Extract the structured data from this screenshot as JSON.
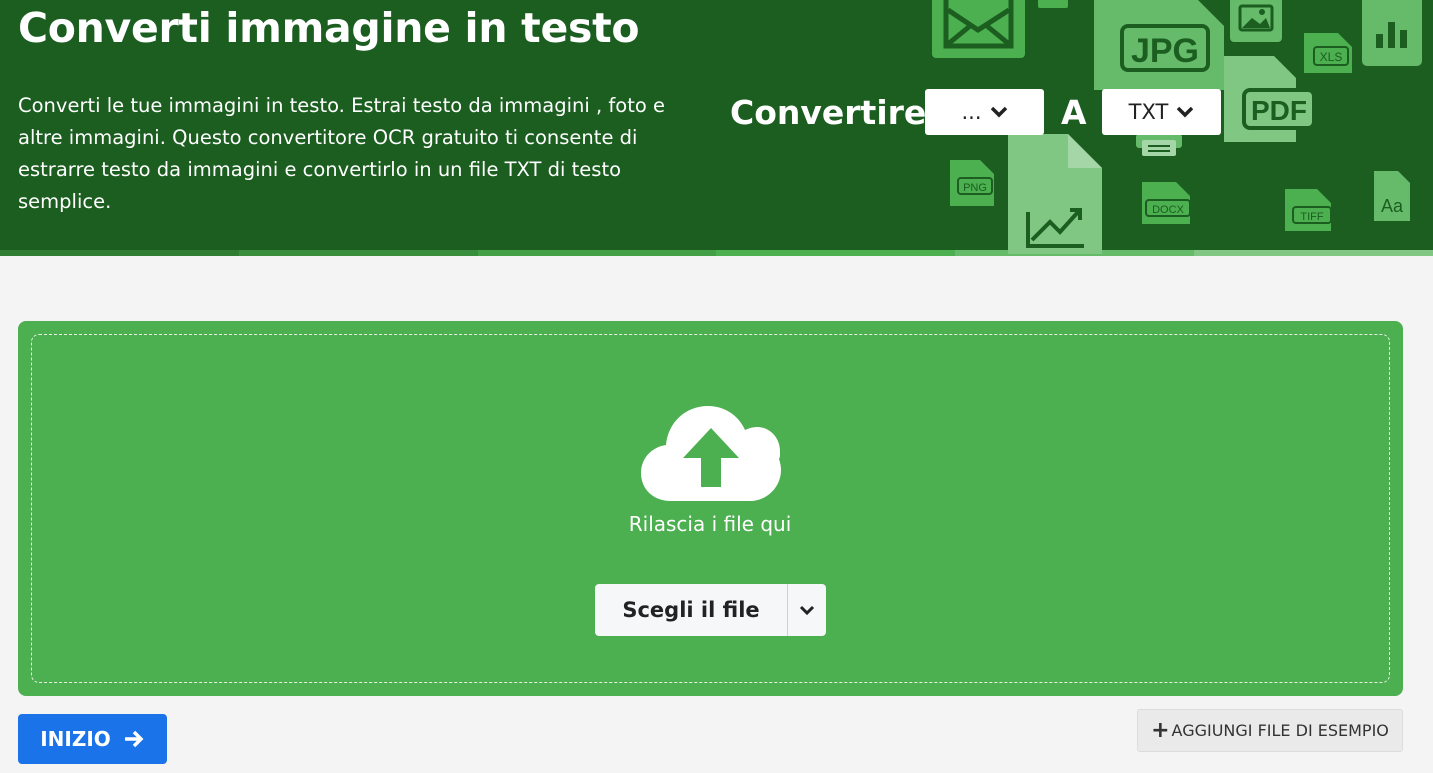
{
  "hero": {
    "title": "Converti immagine in testo",
    "description": "Converti le tue immagini in testo. Estrai testo da immagini , foto e altre immagini. Questo convertitore OCR gratuito ti consente di estrarre testo da immagini e convertirlo in un file TXT di testo semplice.",
    "convert_label": "Convertire",
    "from_value": "...",
    "to_label": "A",
    "to_value": "TXT",
    "deco_labels": {
      "jpg": "JPG",
      "pdf": "PDF",
      "xls": "XLS",
      "png": "PNG",
      "docx": "DOCX",
      "tiff": "TIFF",
      "font": "Aa"
    }
  },
  "dropzone": {
    "drop_text": "Rilascia i file qui",
    "choose_label": "Scegli il file"
  },
  "actions": {
    "start_label": "INIZIO",
    "sample_plus": "+",
    "sample_label": "AGGIUNGI FILE DI ESEMPIO"
  },
  "colors": {
    "hero_bg": "#1b5e20",
    "dropzone_bg": "#4caf50",
    "primary_button": "#1a73e8",
    "deco_green": "#66bb6a"
  }
}
